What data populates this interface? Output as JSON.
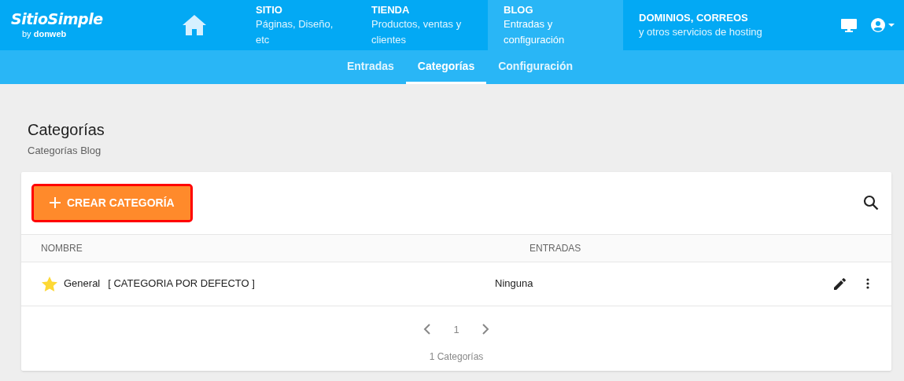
{
  "logo": {
    "name": "SitioSimple",
    "byline_prefix": "by",
    "byline_brand": "donweb"
  },
  "nav": [
    {
      "title": "SITIO",
      "subtitle": "Páginas, Diseño, etc",
      "selected": false
    },
    {
      "title": "TIENDA",
      "subtitle": "Productos, ventas y clientes",
      "selected": false
    },
    {
      "title": "BLOG",
      "subtitle": "Entradas y configuración",
      "selected": true
    },
    {
      "title": "DOMINIOS, CORREOS",
      "subtitle": "y otros servicios de hosting",
      "selected": false
    }
  ],
  "subtabs": [
    {
      "label": "Entradas",
      "selected": false
    },
    {
      "label": "Categorías",
      "selected": true
    },
    {
      "label": "Configuración",
      "selected": false
    }
  ],
  "page": {
    "title": "Categorías",
    "subtitle": "Categorías Blog"
  },
  "create_button": {
    "label": "CREAR CATEGORÍA",
    "highlighted": true
  },
  "table": {
    "columns": [
      "NOMBRE",
      "ENTRADAS"
    ],
    "rows": [
      {
        "name": "General",
        "tag": "[ CATEGORIA POR DEFECTO ]",
        "default": true,
        "entries": "Ninguna"
      }
    ]
  },
  "pagination": {
    "page": "1",
    "summary": "1 Categorías"
  }
}
